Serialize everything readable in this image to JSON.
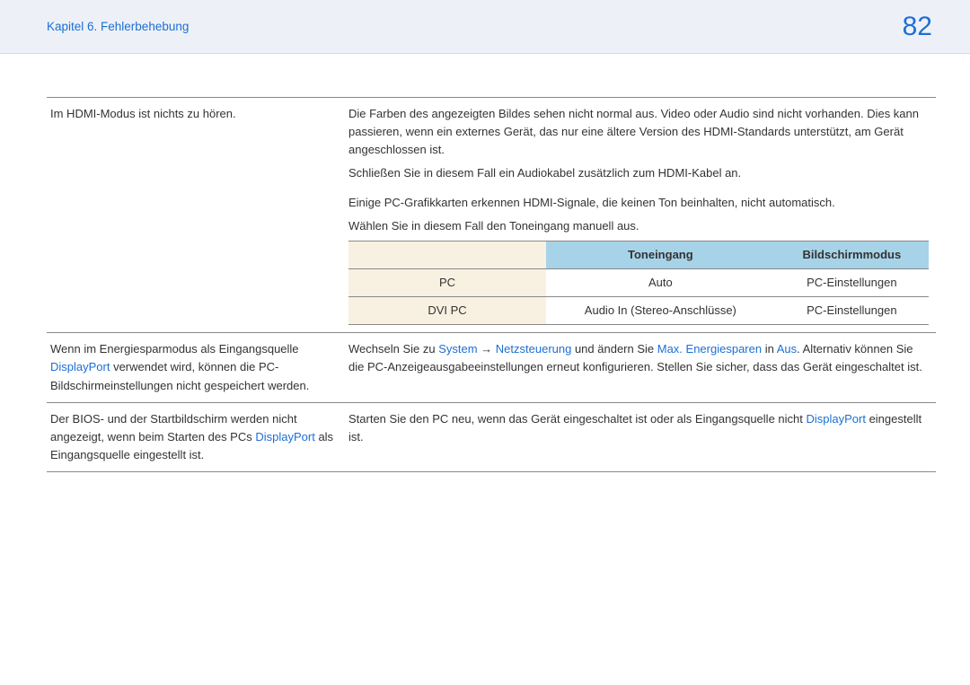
{
  "header": {
    "chapter": "Kapitel 6. Fehlerbehebung",
    "page": "82"
  },
  "rows": {
    "r1_left": "Im HDMI-Modus ist nichts zu hören.",
    "r1_right_p1": "Die Farben des angezeigten Bildes sehen nicht normal aus. Video oder Audio sind nicht vorhanden. Dies kann passieren, wenn ein externes Gerät, das nur eine ältere Version des HDMI-Standards unterstützt, am Gerät angeschlossen ist.",
    "r1_right_p2": "Schließen Sie in diesem Fall ein Audiokabel zusätzlich zum HDMI-Kabel an.",
    "r1_right_p3": "Einige PC-Grafikkarten erkennen HDMI-Signale, die keinen Ton beinhalten, nicht automatisch.",
    "r1_right_p4": "Wählen Sie in diesem Fall den Toneingang manuell aus.",
    "inner_header_a": "",
    "inner_header_b": "Toneingang",
    "inner_header_c": "Bildschirmmodus",
    "inner_r1_a": "PC",
    "inner_r1_b": "Auto",
    "inner_r1_c": "PC-Einstellungen",
    "inner_r2_a": "DVI PC",
    "inner_r2_b": "Audio In (Stereo-Anschlüsse)",
    "inner_r2_c": "PC-Einstellungen",
    "r2_left_a": "Wenn im Energiesparmodus als Eingangsquelle ",
    "r2_left_dp": "DisplayPort",
    "r2_left_b": " verwendet wird, können die PC-Bildschirmeinstellungen nicht gespeichert werden.",
    "r2_right_a": "Wechseln Sie zu ",
    "r2_right_sys": "System",
    "r2_right_arrow": " → ",
    "r2_right_netz": "Netzsteuerung",
    "r2_right_b": " und ändern Sie ",
    "r2_right_max": "Max. Energiesparen",
    "r2_right_c": " in ",
    "r2_right_aus": "Aus",
    "r2_right_d": ". Alternativ können Sie die PC-Anzeigeausgabeeinstellungen erneut konfigurieren. Stellen Sie sicher, dass das Gerät eingeschaltet ist.",
    "r3_left_a": "Der BIOS- und der Startbildschirm werden nicht angezeigt, wenn beim Starten des PCs ",
    "r3_left_dp": "DisplayPort",
    "r3_left_b": " als Eingangsquelle eingestellt ist.",
    "r3_right_a": "Starten Sie den PC neu, wenn das Gerät eingeschaltet ist oder als Eingangsquelle nicht ",
    "r3_right_dp": "DisplayPort",
    "r3_right_b": " eingestellt ist."
  }
}
